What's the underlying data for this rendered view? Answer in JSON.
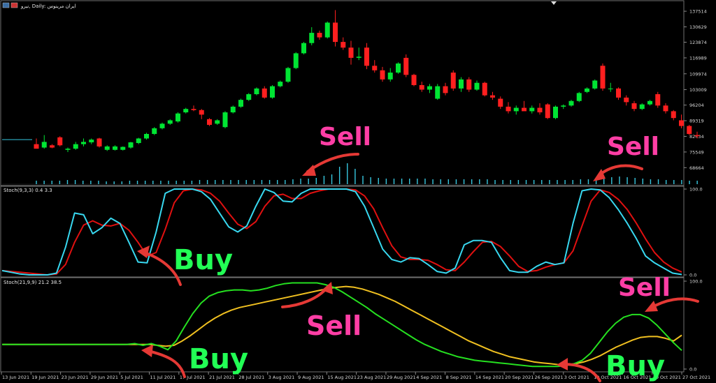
{
  "header": {
    "title": "نیرو, Daily: ایران مرینوس"
  },
  "indicators": {
    "fast": {
      "title": "Stoch(9,3,3) 0.4 3.3"
    },
    "slow": {
      "title": "Stoch(21,9,9) 21.2 38.5"
    }
  },
  "colors": {
    "bull": "#00e533",
    "bear": "#ff1f1f",
    "volume": "#37c8e0",
    "fast_k": "#38d8f0",
    "fast_d": "#e01010",
    "slow_k": "#25e020",
    "slow_d": "#f0c020",
    "background": "#000000"
  },
  "annotations": [
    {
      "text": "Sell"
    },
    {
      "text": "Sell"
    },
    {
      "text": "Buy"
    },
    {
      "text": "Sell"
    },
    {
      "text": "Sell"
    },
    {
      "text": "Buy"
    },
    {
      "text": "Buy"
    }
  ],
  "chart_data": [
    {
      "type": "candlestick",
      "title": "نیرو, Daily: ایران مرینوس",
      "y_ticks": [
        "137514",
        "130629",
        "123874",
        "116989",
        "109974",
        "103009",
        "96204",
        "89319",
        "82434",
        "75549",
        "68664"
      ],
      "ylim": [
        62000,
        140000
      ],
      "x_tick_labels": [
        "13 Jun 2021",
        "19 Jun 2021",
        "23 Jun 2021",
        "29 Jun 2021",
        "5 Jul 2021",
        "11 Jul 2021",
        "17 Jul 2021",
        "21 Jul 2021",
        "28 Jul 2021",
        "3 Aug 2021",
        "9 Aug 2021",
        "15 Aug 2021",
        "23 Aug 2021",
        "29 Aug 2021",
        "4 Sep 2021",
        "8 Sep 2021",
        "14 Sep 2021",
        "20 Sep 2021",
        "26 Sep 2021",
        "3 Oct 2021",
        "10 Oct 2021",
        "16 Oct 2021",
        "20 Oct 2021",
        "27 Oct 2021"
      ],
      "pre_history_price": 81000,
      "candles": [
        [
          79000,
          81500,
          77500,
          77000
        ],
        [
          77500,
          83000,
          77000,
          80000
        ],
        [
          78500,
          79000,
          77200,
          77500
        ],
        [
          82000,
          82500,
          78000,
          78500
        ],
        [
          76500,
          77500,
          75500,
          77000
        ],
        [
          77000,
          80000,
          76500,
          79000
        ],
        [
          79000,
          81500,
          78000,
          80000
        ],
        [
          79800,
          81500,
          79000,
          81000
        ],
        [
          81500,
          81800,
          77500,
          78000
        ],
        [
          76500,
          78500,
          76000,
          78000
        ],
        [
          76500,
          78500,
          76200,
          78000
        ],
        [
          76500,
          78000,
          76200,
          77800
        ],
        [
          77500,
          80000,
          77000,
          79800
        ],
        [
          79500,
          81800,
          79000,
          81500
        ],
        [
          81500,
          84000,
          81000,
          83500
        ],
        [
          83500,
          86500,
          83000,
          86000
        ],
        [
          86000,
          88500,
          85500,
          88000
        ],
        [
          88000,
          90000,
          87500,
          89500
        ],
        [
          89000,
          93000,
          88500,
          92500
        ],
        [
          93000,
          95000,
          92500,
          94500
        ],
        [
          94500,
          96000,
          93500,
          94000
        ],
        [
          94000,
          94500,
          90000,
          92000
        ],
        [
          90000,
          90500,
          87000,
          87500
        ],
        [
          88000,
          90000,
          87500,
          89500
        ],
        [
          86500,
          93500,
          86000,
          93000
        ],
        [
          93000,
          96000,
          92500,
          95500
        ],
        [
          95500,
          99000,
          95000,
          98500
        ],
        [
          98500,
          101500,
          98000,
          101000
        ],
        [
          101000,
          104000,
          100500,
          103500
        ],
        [
          103500,
          104500,
          99000,
          99500
        ],
        [
          99500,
          105000,
          99000,
          104500
        ],
        [
          104500,
          107000,
          104000,
          106500
        ],
        [
          106500,
          113000,
          106000,
          112500
        ],
        [
          112500,
          119500,
          112000,
          119000
        ],
        [
          119000,
          124000,
          118500,
          123500
        ],
        [
          123500,
          130500,
          122500,
          128000
        ],
        [
          128000,
          129000,
          125000,
          126000
        ],
        [
          126000,
          133000,
          125500,
          132500
        ],
        [
          132500,
          138000,
          122000,
          124000
        ],
        [
          124000,
          126000,
          120500,
          121500
        ],
        [
          121500,
          124500,
          114000,
          117000
        ],
        [
          117000,
          121500,
          116000,
          117500
        ],
        [
          121500,
          123500,
          112000,
          113500
        ],
        [
          113500,
          116000,
          110500,
          111500
        ],
        [
          111500,
          113000,
          106500,
          107500
        ],
        [
          107500,
          112500,
          106500,
          110500
        ],
        [
          110500,
          115000,
          110000,
          114500
        ],
        [
          117000,
          118500,
          108500,
          109500
        ],
        [
          109500,
          110000,
          104500,
          105000
        ],
        [
          105000,
          106500,
          102000,
          103000
        ],
        [
          103000,
          105500,
          101500,
          104500
        ],
        [
          99000,
          105500,
          98500,
          104500
        ],
        [
          104500,
          106000,
          100500,
          101500
        ],
        [
          110500,
          111500,
          102500,
          103500
        ],
        [
          103500,
          108500,
          102000,
          107500
        ],
        [
          107500,
          108500,
          102000,
          103000
        ],
        [
          103000,
          107000,
          102500,
          106000
        ],
        [
          106000,
          106500,
          100000,
          100500
        ],
        [
          100500,
          102000,
          98500,
          99500
        ],
        [
          99000,
          100000,
          94500,
          95500
        ],
        [
          95500,
          97500,
          92500,
          93500
        ],
        [
          93500,
          96000,
          92000,
          95000
        ],
        [
          95000,
          98000,
          94000,
          93500
        ],
        [
          93500,
          96000,
          92500,
          95000
        ],
        [
          95000,
          97000,
          92000,
          93000
        ],
        [
          96500,
          97000,
          90000,
          90500
        ],
        [
          90500,
          96000,
          90000,
          95500
        ],
        [
          95500,
          96500,
          94500,
          96000
        ],
        [
          96000,
          98500,
          95500,
          98000
        ],
        [
          98000,
          102000,
          97500,
          101500
        ],
        [
          102000,
          104000,
          101500,
          103500
        ],
        [
          103500,
          107500,
          103000,
          107000
        ],
        [
          113500,
          114500,
          102500,
          103500
        ],
        [
          103500,
          106000,
          102000,
          103500
        ],
        [
          103500,
          104000,
          98500,
          99500
        ],
        [
          99500,
          100500,
          96000,
          97500
        ],
        [
          97000,
          98000,
          93500,
          94500
        ],
        [
          94500,
          97000,
          94000,
          96500
        ],
        [
          96500,
          98500,
          96000,
          98000
        ],
        [
          101000,
          102000,
          95000,
          96000
        ],
        [
          96000,
          97000,
          92500,
          93500
        ],
        [
          93500,
          94000,
          89500,
          90500
        ],
        [
          89500,
          92000,
          86000,
          87000
        ],
        [
          87000,
          87500,
          83000,
          83500
        ],
        [
          83000,
          84500,
          81500,
          82500
        ]
      ],
      "volumes": [
        5,
        5,
        5,
        5,
        6,
        6,
        5,
        5,
        5,
        4,
        4,
        4,
        5,
        5,
        5,
        5,
        5,
        5,
        5,
        5,
        5,
        6,
        6,
        6,
        6,
        6,
        6,
        6,
        6,
        6,
        6,
        6,
        6,
        7,
        8,
        8,
        9,
        12,
        14,
        25,
        30,
        22,
        12,
        10,
        9,
        8,
        8,
        8,
        8,
        8,
        8,
        7,
        7,
        7,
        7,
        7,
        7,
        7,
        7,
        6,
        6,
        6,
        6,
        6,
        6,
        6,
        6,
        6,
        6,
        6,
        7,
        7,
        7,
        8,
        10,
        11,
        10,
        9,
        8,
        7,
        7,
        6,
        6,
        6,
        5,
        5
      ]
    },
    {
      "type": "line",
      "title": "Stoch(9,3,3) 0.4 3.3",
      "ylim": [
        0,
        100
      ],
      "y_ticks": [
        "100.0",
        "0.0"
      ],
      "series": [
        {
          "name": "%K",
          "values": [
            5,
            3,
            1,
            0,
            0,
            0,
            2,
            32,
            72,
            70,
            48,
            55,
            66,
            60,
            38,
            15,
            14,
            50,
            95,
            100,
            100,
            100,
            97,
            88,
            72,
            56,
            50,
            57,
            80,
            100,
            96,
            86,
            85,
            95,
            100,
            100,
            100,
            100,
            100,
            97,
            80,
            55,
            30,
            18,
            15,
            20,
            19,
            12,
            4,
            2,
            8,
            35,
            40,
            40,
            38,
            20,
            5,
            3,
            3,
            10,
            15,
            12,
            14,
            60,
            98,
            100,
            99,
            90,
            76,
            60,
            42,
            22,
            14,
            8,
            2,
            0.4
          ]
        },
        {
          "name": "%D",
          "values": [
            5,
            4,
            3,
            2,
            1,
            0,
            1,
            12,
            38,
            58,
            63,
            58,
            57,
            60,
            52,
            38,
            22,
            26,
            53,
            84,
            98,
            100,
            99,
            95,
            86,
            72,
            59,
            54,
            62,
            80,
            92,
            94,
            89,
            89,
            95,
            98,
            100,
            100,
            100,
            99,
            92,
            77,
            55,
            34,
            21,
            18,
            18,
            17,
            12,
            6,
            5,
            15,
            27,
            38,
            39,
            33,
            22,
            10,
            4,
            5,
            9,
            12,
            14,
            28,
            57,
            86,
            99,
            96,
            88,
            76,
            60,
            42,
            26,
            15,
            8,
            3.3
          ]
        }
      ]
    },
    {
      "type": "line",
      "title": "Stoch(21,9,9) 21.2 38.5",
      "ylim": [
        0,
        100
      ],
      "y_ticks": [
        "100.0",
        "0.0"
      ],
      "series": [
        {
          "name": "%K",
          "values": [
            28,
            28,
            28,
            28,
            28,
            28,
            28,
            28,
            28,
            28,
            28,
            28,
            28,
            28,
            28,
            28,
            29,
            27,
            29,
            26,
            22,
            32,
            48,
            63,
            75,
            83,
            87,
            89,
            90,
            90,
            89,
            90,
            92,
            95,
            97,
            98,
            98,
            98,
            98,
            96,
            93,
            88,
            82,
            76,
            70,
            63,
            57,
            51,
            45,
            39,
            33,
            28,
            24,
            20,
            17,
            14,
            12,
            10,
            9,
            8,
            7,
            6,
            5,
            4,
            3,
            3,
            3,
            3,
            4,
            6,
            10,
            18,
            30,
            42,
            52,
            59,
            62,
            62,
            58,
            50,
            40,
            30,
            21.2
          ]
        },
        {
          "name": "%D",
          "values": [
            28,
            28,
            28,
            28,
            28,
            28,
            28,
            28,
            28,
            28,
            28,
            28,
            28,
            28,
            28,
            28,
            28,
            28,
            28,
            27,
            26,
            27,
            32,
            38,
            45,
            52,
            58,
            63,
            67,
            70,
            72,
            74,
            76,
            78,
            80,
            82,
            84,
            86,
            88,
            90,
            92,
            93,
            94,
            93,
            91,
            88,
            85,
            81,
            77,
            72,
            67,
            62,
            57,
            52,
            47,
            42,
            37,
            32,
            28,
            24,
            20,
            17,
            14,
            12,
            10,
            8,
            7,
            6,
            5,
            5,
            6,
            8,
            11,
            15,
            20,
            25,
            29,
            33,
            36,
            37,
            37,
            35,
            32,
            38.5
          ]
        }
      ]
    }
  ]
}
